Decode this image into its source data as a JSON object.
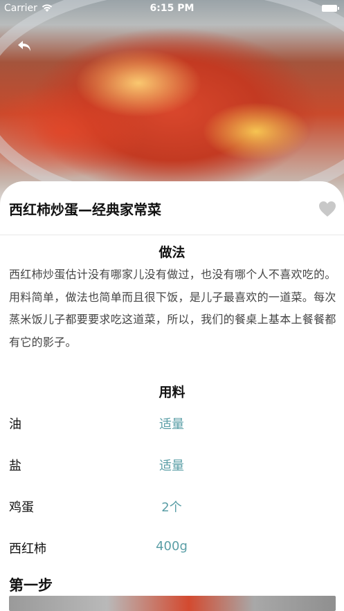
{
  "status_bar": {
    "carrier": "Carrier",
    "time": "6:15 PM"
  },
  "header": {
    "back_icon": "back-arrow-icon",
    "hero_image": "tomato-egg-dish-photo"
  },
  "recipe": {
    "title": "西红柿炒蛋—经典家常菜",
    "favorite_icon": "heart-icon",
    "method_title": "做法",
    "description": "西红柿炒蛋估计没有哪家儿没有做过，也没有哪个人不喜欢吃的。用料简单，做法也简单而且很下饭，是儿子最喜欢的一道菜。每次蒸米饭儿子都要要求吃这道菜，所以，我们的餐桌上基本上餐餐都有它的影子。",
    "ingredients_title": "用料",
    "ingredients": [
      {
        "name": "油",
        "amount": "适量"
      },
      {
        "name": "盐",
        "amount": "适量"
      },
      {
        "name": "鸡蛋",
        "amount": "2个"
      },
      {
        "name": "西红柿",
        "amount": "400g"
      }
    ],
    "step_title": "第一步"
  },
  "colors": {
    "accent": "#5a9ea6",
    "heart": "#c8c8c8"
  }
}
